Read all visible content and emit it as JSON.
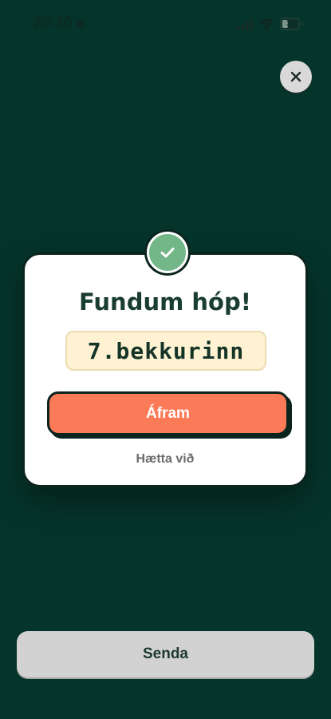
{
  "status_bar": {
    "time": "20:30",
    "battery_level": "36",
    "battery_fraction": 0.36,
    "icons": [
      "bell-slash-icon",
      "signal-icon",
      "wifi-icon",
      "battery-icon"
    ]
  },
  "close_button": {
    "icon": "close-icon"
  },
  "dialog": {
    "title": "Fundum hóp!",
    "group_name": "7.bekkurinn",
    "continue_label": "Áfram",
    "cancel_label": "Hætta við",
    "badge_icon": "check-icon"
  },
  "footer": {
    "send_label": "Senda"
  },
  "colors": {
    "background": "#05342a",
    "accent": "#fb7b58",
    "success": "#73b687",
    "field_bg": "#fff2d2",
    "disabled_button": "#d2d2d2"
  }
}
